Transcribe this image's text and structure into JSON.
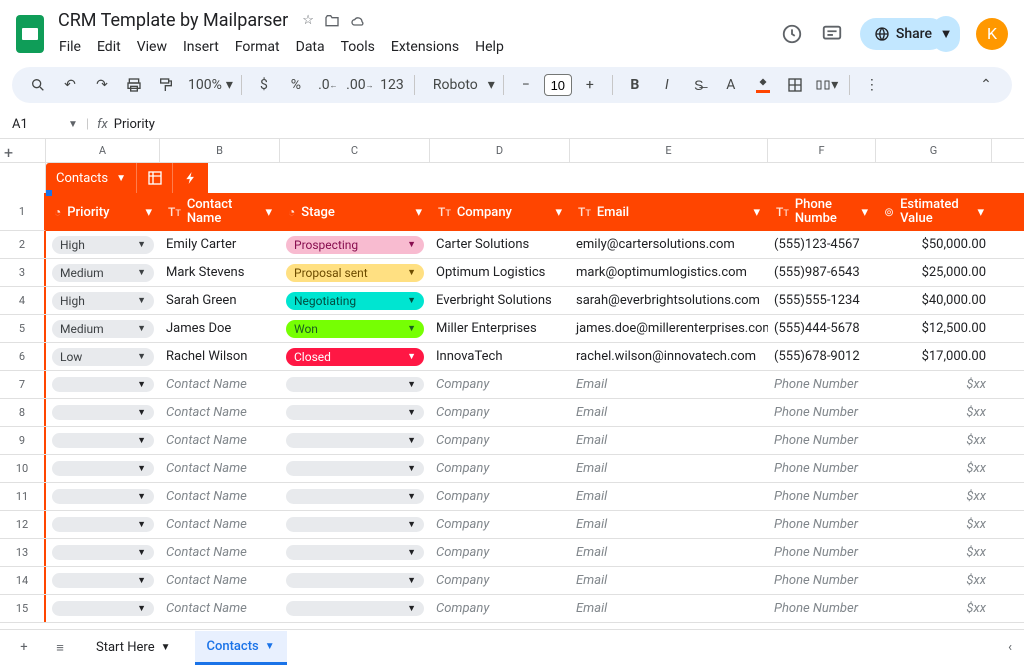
{
  "doc_title": "CRM Template by Mailparser",
  "menus": [
    "File",
    "Edit",
    "View",
    "Insert",
    "Format",
    "Data",
    "Tools",
    "Extensions",
    "Help"
  ],
  "share_label": "Share",
  "avatar_letter": "K",
  "zoom": "100%",
  "font_name": "Roboto",
  "font_size": "10",
  "cell_ref": "A1",
  "fx_value": "Priority",
  "col_letters": [
    "A",
    "B",
    "C",
    "D",
    "E",
    "F",
    "G"
  ],
  "tab_chip": "Contacts",
  "headers": {
    "priority": "Priority",
    "contact": "Contact Name",
    "stage": "Stage",
    "company": "Company",
    "email": "Email",
    "phone": "Phone Numbe",
    "value": "Estimated Value"
  },
  "rows": [
    {
      "n": "2",
      "priority": "High",
      "contact": "Emily Carter",
      "stage": "Prospecting",
      "stage_bg": "#f8bbd0",
      "stage_fg": "#880e4f",
      "company": "Carter Solutions",
      "email": "emily@cartersolutions.com",
      "phone": "(555)123-4567",
      "value": "$50,000.00"
    },
    {
      "n": "3",
      "priority": "Medium",
      "contact": "Mark Stevens",
      "stage": "Proposal sent",
      "stage_bg": "#ffe082",
      "stage_fg": "#6d4c00",
      "company": "Optimum Logistics",
      "email": "mark@optimumlogistics.com",
      "phone": "(555)987-6543",
      "value": "$25,000.00"
    },
    {
      "n": "4",
      "priority": "High",
      "contact": "Sarah Green",
      "stage": "Negotiating",
      "stage_bg": "#00e5d1",
      "stage_fg": "#004d40",
      "company": "Everbright Solutions",
      "email": "sarah@everbrightsolutions.com",
      "phone": "(555)555-1234",
      "value": "$40,000.00"
    },
    {
      "n": "5",
      "priority": "Medium",
      "contact": "James Doe",
      "stage": "Won",
      "stage_bg": "#76ff03",
      "stage_fg": "#1b5e20",
      "company": "Miller Enterprises",
      "email": "james.doe@millerenterprises.com",
      "phone": "(555)444-5678",
      "value": "$12,500.00"
    },
    {
      "n": "6",
      "priority": "Low",
      "contact": "Rachel Wilson",
      "stage": "Closed",
      "stage_bg": "#ff1744",
      "stage_fg": "#ffffff",
      "company": "InnovaTech",
      "email": "rachel.wilson@innovatech.com",
      "phone": "(555)678-9012",
      "value": "$17,000.00"
    }
  ],
  "placeholder_rows": [
    "7",
    "8",
    "9",
    "10",
    "11",
    "12",
    "13",
    "14",
    "15"
  ],
  "placeholders": {
    "contact": "Contact Name",
    "company": "Company",
    "email": "Email",
    "phone": "Phone Number",
    "value": "$xx"
  },
  "sheet_tabs": {
    "start": "Start Here",
    "contacts": "Contacts"
  }
}
